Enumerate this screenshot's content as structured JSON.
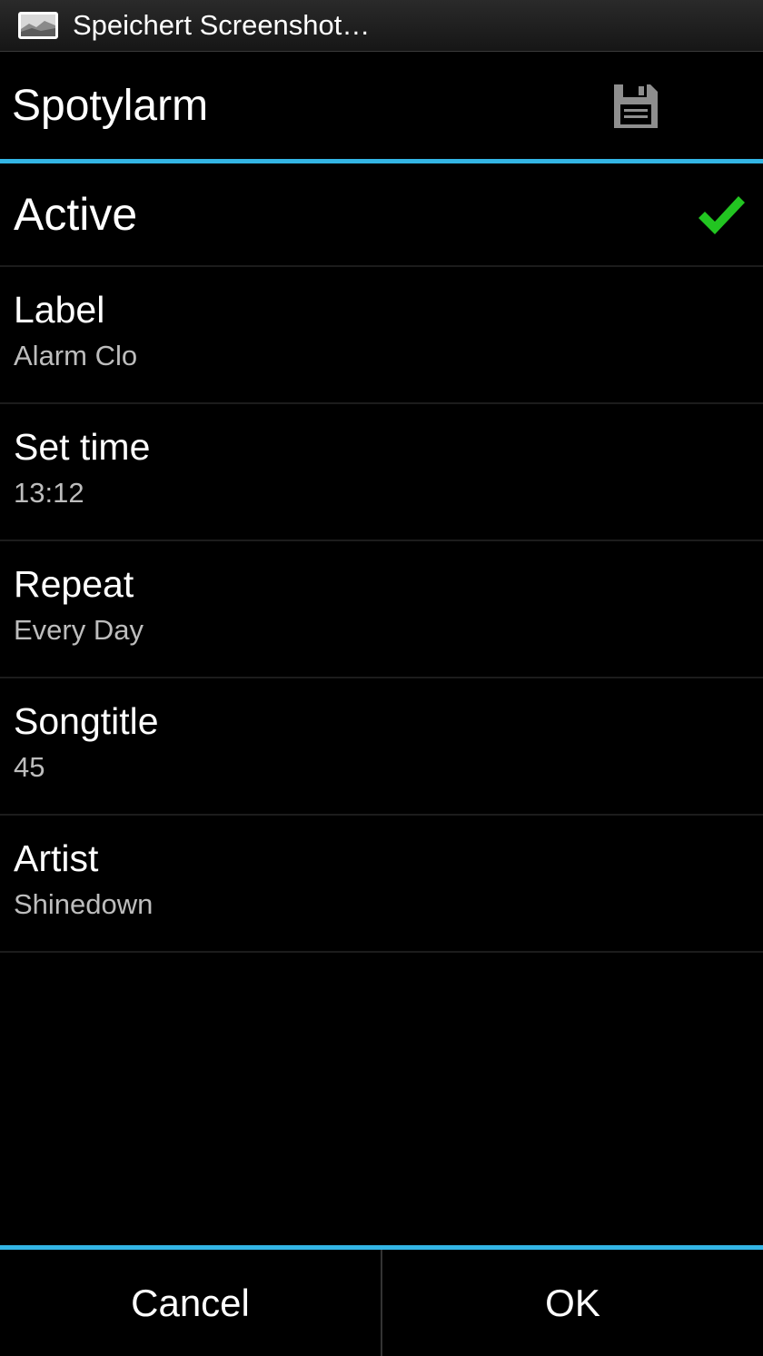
{
  "status_bar": {
    "notification_icon": "screenshot-icon",
    "notification_text": "Speichert Screenshot…"
  },
  "action_bar": {
    "title": "Spotylarm",
    "save_icon": "floppy-disk-icon"
  },
  "active_row": {
    "label": "Active",
    "checked": true,
    "check_color": "#22c521"
  },
  "settings": [
    {
      "title": "Label",
      "value": "Alarm Clo"
    },
    {
      "title": "Set time",
      "value": "13:12"
    },
    {
      "title": "Repeat",
      "value": "Every Day"
    },
    {
      "title": "Songtitle",
      "value": "45"
    },
    {
      "title": "Artist",
      "value": "Shinedown"
    }
  ],
  "buttons": {
    "cancel": "Cancel",
    "ok": "OK"
  },
  "colors": {
    "accent": "#33b5e5",
    "background": "#000000",
    "secondary_text": "#bdbdbd"
  }
}
